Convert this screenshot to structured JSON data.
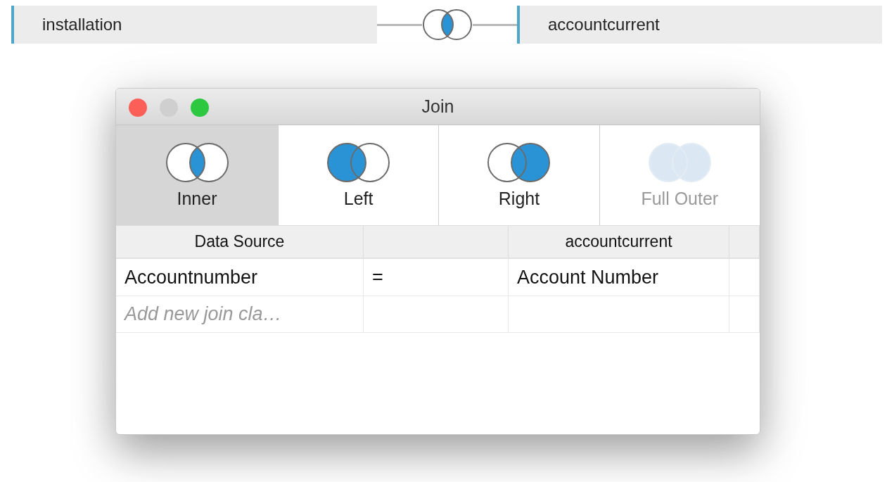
{
  "join_bar": {
    "left_table": "installation",
    "right_table": "accountcurrent"
  },
  "window": {
    "title": "Join"
  },
  "join_types": [
    {
      "label": "Inner",
      "kind": "inner",
      "selected": true,
      "disabled": false
    },
    {
      "label": "Left",
      "kind": "left",
      "selected": false,
      "disabled": false
    },
    {
      "label": "Right",
      "kind": "right",
      "selected": false,
      "disabled": false
    },
    {
      "label": "Full Outer",
      "kind": "full",
      "selected": false,
      "disabled": true
    }
  ],
  "table": {
    "columns": [
      "Data Source",
      "accountcurrent"
    ],
    "rows": [
      {
        "left": "Accountnumber",
        "operator": "=",
        "right": "Account Number"
      }
    ],
    "placeholder": "Add new join cla…"
  }
}
